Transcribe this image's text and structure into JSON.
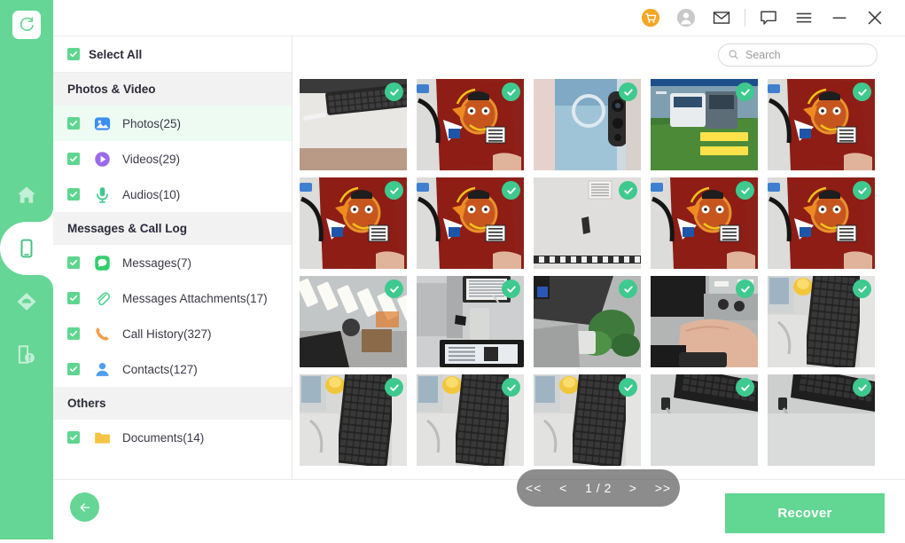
{
  "rail": {
    "logo_icon": "refresh-logo-icon",
    "items": [
      {
        "icon": "home-icon",
        "name": "home",
        "active": false
      },
      {
        "icon": "phone-device-icon",
        "name": "device",
        "active": true
      },
      {
        "icon": "cloud-icon",
        "name": "cloud",
        "active": false
      },
      {
        "icon": "document-alert-icon",
        "name": "repair",
        "active": false
      }
    ],
    "color": "#65d695"
  },
  "titlebar": {
    "buttons": [
      {
        "icon": "cart-icon",
        "name": "cart",
        "color": "#f5a623"
      },
      {
        "icon": "account-icon",
        "name": "account",
        "color": "#c4c4c4"
      },
      {
        "icon": "mail-icon",
        "name": "mail",
        "color": "#444444"
      },
      {
        "icon": "chat-icon",
        "name": "feedback",
        "color": "#444444"
      },
      {
        "icon": "menu-icon",
        "name": "menu",
        "color": "#444444"
      },
      {
        "icon": "minimize-icon",
        "name": "minimize",
        "color": "#444444"
      },
      {
        "icon": "close-icon",
        "name": "close",
        "color": "#444444"
      }
    ]
  },
  "sidebar": {
    "select_all_label": "Select All",
    "select_all_checked": true,
    "groups": [
      {
        "title": "Photos & Video",
        "items": [
          {
            "label": "Photos(25)",
            "icon": "photo-icon",
            "checked": true,
            "selected": true
          },
          {
            "label": "Videos(29)",
            "icon": "video-icon",
            "checked": true,
            "selected": false
          },
          {
            "label": "Audios(10)",
            "icon": "audio-icon",
            "checked": true,
            "selected": false
          }
        ]
      },
      {
        "title": "Messages & Call Log",
        "items": [
          {
            "label": "Messages(7)",
            "icon": "message-icon",
            "checked": true,
            "selected": false
          },
          {
            "label": "Messages Attachments(17)",
            "icon": "attachment-icon",
            "checked": true,
            "selected": false
          },
          {
            "label": "Call History(327)",
            "icon": "call-icon",
            "checked": true,
            "selected": false
          },
          {
            "label": "Contacts(127)",
            "icon": "contact-icon",
            "checked": true,
            "selected": false
          }
        ]
      },
      {
        "title": "Others",
        "items": [
          {
            "label": "Documents(14)",
            "icon": "folder-icon",
            "checked": true,
            "selected": false
          }
        ]
      }
    ]
  },
  "search": {
    "placeholder": "Search",
    "value": "",
    "icon": "search-icon"
  },
  "gallery": {
    "columns": 5,
    "rows": 4,
    "thumbnails": [
      {
        "id": 1,
        "caption": "keyboard on white desk",
        "selected": true
      },
      {
        "id": 2,
        "caption": "red snack package with mascot",
        "selected": true
      },
      {
        "id": 3,
        "caption": "blue phone back camera",
        "selected": true
      },
      {
        "id": 4,
        "caption": "green train poster",
        "selected": true
      },
      {
        "id": 5,
        "caption": "red snack package with mascot",
        "selected": true
      },
      {
        "id": 6,
        "caption": "red snack package with mascot",
        "selected": true
      },
      {
        "id": 7,
        "caption": "red snack package with mascot",
        "selected": true
      },
      {
        "id": 8,
        "caption": "white wall and device",
        "selected": true
      },
      {
        "id": 9,
        "caption": "red snack package with mascot",
        "selected": true
      },
      {
        "id": 10,
        "caption": "red snack package with mascot",
        "selected": true
      },
      {
        "id": 11,
        "caption": "office ceiling lights",
        "selected": true
      },
      {
        "id": 12,
        "caption": "desktop monitor on desk",
        "selected": true
      },
      {
        "id": 13,
        "caption": "monitor with plant",
        "selected": true
      },
      {
        "id": 14,
        "caption": "hand using mouse in office",
        "selected": true
      },
      {
        "id": 15,
        "caption": "keyboard with yellow toy",
        "selected": true
      },
      {
        "id": 16,
        "caption": "keyboard on desk",
        "selected": true
      },
      {
        "id": 17,
        "caption": "keyboard and cable",
        "selected": true
      },
      {
        "id": 18,
        "caption": "keyboard with yellow toy",
        "selected": true
      },
      {
        "id": 19,
        "caption": "monitor edge and pen",
        "selected": true
      },
      {
        "id": 20,
        "caption": "keyboard and pen on desk",
        "selected": true
      }
    ]
  },
  "pagination": {
    "first_label": "<<",
    "prev_label": "<",
    "page_label": "1 / 2",
    "next_label": ">",
    "last_label": ">>",
    "current_page": 1,
    "total_pages": 2
  },
  "footer": {
    "back_icon": "back-arrow-icon",
    "recover_label": "Recover",
    "recover_color": "#62d693"
  }
}
